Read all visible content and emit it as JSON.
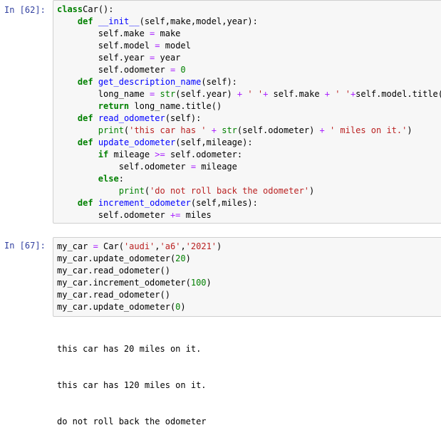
{
  "cells": [
    {
      "prompt": "In  [62]:",
      "lines": [
        [
          [
            "kw",
            "class"
          ],
          [
            "",
            "Car"
          ],
          [
            "op",
            ""
          ],
          [
            "",
            "():"
          ]
        ],
        [
          [
            "",
            "    "
          ],
          [
            "kw",
            "def"
          ],
          [
            "",
            " "
          ],
          [
            "fn",
            "__init__"
          ],
          [
            "",
            "(self,make,model,year):"
          ]
        ],
        [
          [
            "",
            "        self.make "
          ],
          [
            "op",
            "="
          ],
          [
            "",
            " make"
          ]
        ],
        [
          [
            "",
            "        self.model "
          ],
          [
            "op",
            "="
          ],
          [
            "",
            " model"
          ]
        ],
        [
          [
            "",
            "        self.year "
          ],
          [
            "op",
            "="
          ],
          [
            "",
            " year"
          ]
        ],
        [
          [
            "",
            "        self.odometer "
          ],
          [
            "op",
            "="
          ],
          [
            "",
            " "
          ],
          [
            "num",
            "0"
          ]
        ],
        [
          [
            "",
            "    "
          ],
          [
            "kw",
            "def"
          ],
          [
            "",
            " "
          ],
          [
            "fn",
            "get_description_name"
          ],
          [
            "",
            "(self):"
          ]
        ],
        [
          [
            "",
            "        long_name "
          ],
          [
            "op",
            "="
          ],
          [
            "",
            " "
          ],
          [
            "bi",
            "str"
          ],
          [
            "",
            "(self.year) "
          ],
          [
            "op",
            "+"
          ],
          [
            "",
            " "
          ],
          [
            "str",
            "' '"
          ],
          [
            "op",
            "+"
          ],
          [
            "",
            " self.make "
          ],
          [
            "op",
            "+"
          ],
          [
            "",
            " "
          ],
          [
            "str",
            "' '"
          ],
          [
            "op",
            "+"
          ],
          [
            "",
            "self.model.title()"
          ]
        ],
        [
          [
            "",
            "        "
          ],
          [
            "kw",
            "return"
          ],
          [
            "",
            " long_name.title()"
          ]
        ],
        [
          [
            "",
            "    "
          ],
          [
            "kw",
            "def"
          ],
          [
            "",
            " "
          ],
          [
            "fn",
            "read_odometer"
          ],
          [
            "",
            "(self):"
          ]
        ],
        [
          [
            "",
            "        "
          ],
          [
            "bi",
            "print"
          ],
          [
            "",
            "("
          ],
          [
            "str",
            "'this car has '"
          ],
          [
            "",
            " "
          ],
          [
            "op",
            "+"
          ],
          [
            "",
            " "
          ],
          [
            "bi",
            "str"
          ],
          [
            "",
            "(self.odometer) "
          ],
          [
            "op",
            "+"
          ],
          [
            "",
            " "
          ],
          [
            "str",
            "' miles on it.'"
          ],
          [
            "",
            ")"
          ]
        ],
        [
          [
            "",
            "    "
          ],
          [
            "kw",
            "def"
          ],
          [
            "",
            " "
          ],
          [
            "fn",
            "update_odometer"
          ],
          [
            "",
            "(self,mileage):"
          ]
        ],
        [
          [
            "",
            "        "
          ],
          [
            "kw",
            "if"
          ],
          [
            "",
            " mileage "
          ],
          [
            "op",
            ">="
          ],
          [
            "",
            " self.odometer:"
          ]
        ],
        [
          [
            "",
            "            self.odometer "
          ],
          [
            "op",
            "="
          ],
          [
            "",
            " mileage"
          ]
        ],
        [
          [
            "",
            "        "
          ],
          [
            "kw",
            "else"
          ],
          [
            "",
            ":"
          ]
        ],
        [
          [
            "",
            "            "
          ],
          [
            "bi",
            "print"
          ],
          [
            "",
            "("
          ],
          [
            "str",
            "'do not roll back the odometer'"
          ],
          [
            "",
            ")"
          ]
        ],
        [
          [
            "",
            "    "
          ],
          [
            "kw",
            "def"
          ],
          [
            "",
            " "
          ],
          [
            "fn",
            "increment_odometer"
          ],
          [
            "",
            "(self,miles):"
          ]
        ],
        [
          [
            "",
            "        self.odometer "
          ],
          [
            "op",
            "+="
          ],
          [
            "",
            " miles"
          ]
        ]
      ]
    },
    {
      "prompt": "In  [67]:",
      "lines": [
        [
          [
            "",
            "my_car "
          ],
          [
            "op",
            "="
          ],
          [
            "",
            " Car("
          ],
          [
            "str",
            "'audi'"
          ],
          [
            "",
            ","
          ],
          [
            "str",
            "'a6'"
          ],
          [
            "",
            ","
          ],
          [
            "str",
            "'2021'"
          ],
          [
            "",
            ")"
          ]
        ],
        [
          [
            "",
            "my_car.update_odometer("
          ],
          [
            "num",
            "20"
          ],
          [
            "",
            ")"
          ]
        ],
        [
          [
            "",
            "my_car.read_odometer()"
          ]
        ],
        [
          [
            "",
            "my_car.increment_odometer("
          ],
          [
            "num",
            "100"
          ],
          [
            "",
            ")"
          ]
        ],
        [
          [
            "",
            "my_car.read_odometer()"
          ]
        ],
        [
          [
            "",
            "my_car.update_odometer("
          ],
          [
            "num",
            "0"
          ],
          [
            "",
            ")"
          ]
        ]
      ]
    }
  ],
  "output": [
    "this car has 20 miles on it.",
    "this car has 120 miles on it.",
    "do not roll back the odometer"
  ],
  "colors": {
    "prompt": "#303f9f",
    "keyword": "#008000",
    "function": "#0000ff",
    "string": "#ba2121",
    "operator": "#aa22ff",
    "cell_background": "#f7f7f7",
    "cell_border": "#cfcfcf"
  }
}
